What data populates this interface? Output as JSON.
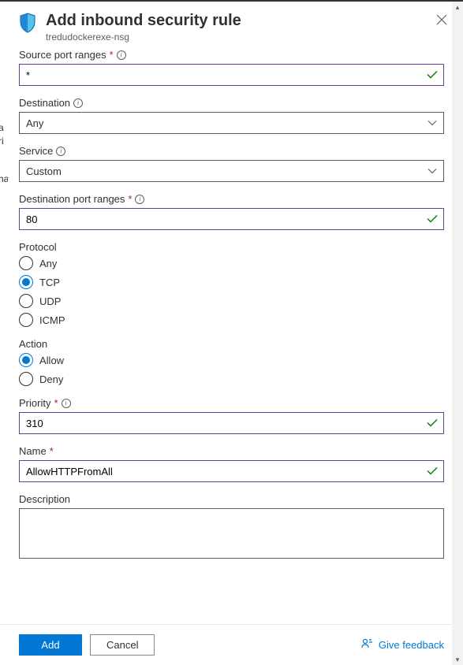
{
  "header": {
    "title": "Add inbound security rule",
    "subtitle": "tredudockerexe-nsg"
  },
  "fields": {
    "sourcePortRanges": {
      "label": "Source port ranges",
      "value": "*",
      "required": true,
      "info": true
    },
    "destination": {
      "label": "Destination",
      "value": "Any",
      "info": true
    },
    "service": {
      "label": "Service",
      "value": "Custom",
      "info": true
    },
    "destinationPortRanges": {
      "label": "Destination port ranges",
      "value": "80",
      "required": true,
      "info": true
    },
    "protocol": {
      "label": "Protocol",
      "options": [
        "Any",
        "TCP",
        "UDP",
        "ICMP"
      ],
      "selected": "TCP"
    },
    "action": {
      "label": "Action",
      "options": [
        "Allow",
        "Deny"
      ],
      "selected": "Allow"
    },
    "priority": {
      "label": "Priority",
      "value": "310",
      "required": true,
      "info": true
    },
    "name": {
      "label": "Name",
      "value": "AllowHTTPFromAll",
      "required": true
    },
    "description": {
      "label": "Description",
      "value": ""
    }
  },
  "footer": {
    "add": "Add",
    "cancel": "Cancel",
    "feedback": "Give feedback"
  }
}
